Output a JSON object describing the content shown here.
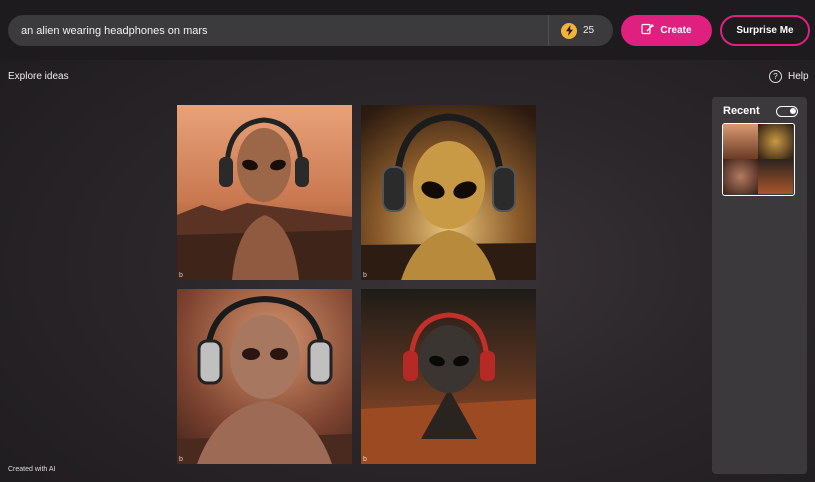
{
  "search": {
    "prompt": "an alien wearing headphones on mars"
  },
  "boosts": {
    "count": "25",
    "icon": "lightning-icon"
  },
  "buttons": {
    "create_label": "Create",
    "surprise_label": "Surprise Me"
  },
  "toolbar": {
    "explore_label": "Explore ideas",
    "help_label": "Help",
    "help_glyph": "?"
  },
  "results": {
    "watermark": "b",
    "images": [
      {
        "name": "alien-headphones-1"
      },
      {
        "name": "alien-headphones-2"
      },
      {
        "name": "alien-headphones-3"
      },
      {
        "name": "alien-headphones-4"
      }
    ]
  },
  "recent": {
    "title": "Recent",
    "toggle_on": true
  },
  "footer": {
    "note": "Created with AI"
  },
  "colors": {
    "accent": "#e0207f",
    "boost": "#f2b436",
    "panel": "#3b393c"
  }
}
